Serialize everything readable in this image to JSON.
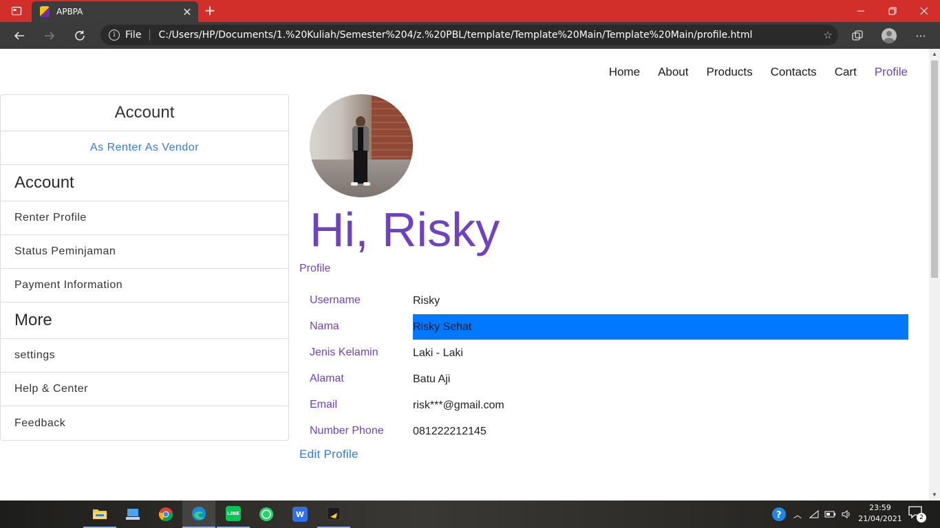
{
  "browser": {
    "tab_title": "APBPA",
    "tab_close": "✕",
    "new_tab": "+",
    "scheme_label": "File",
    "url": "C:/Users/HP/Documents/1.%20Kuliah/Semester%204/z.%20PBL/template/Template%20Main/Template%20Main/profile.html"
  },
  "nav": {
    "links": [
      "Home",
      "About",
      "Products",
      "Contacts",
      "Cart",
      "Profile"
    ],
    "active": "Profile"
  },
  "sidebar": {
    "header": "Account",
    "role_links": "As Renter As Vendor",
    "section_account": "Account",
    "account_items": [
      "Renter Profile",
      "Status Peminjaman",
      "Payment Information"
    ],
    "section_more": "More",
    "more_items": [
      "settings",
      "Help & Center",
      "Feedback"
    ]
  },
  "profile": {
    "greeting": "Hi, Risky",
    "section_label": "Profile",
    "fields": [
      {
        "label": "Username",
        "value": "Risky"
      },
      {
        "label": "Nama",
        "value": "Risky Sehat"
      },
      {
        "label": "Jenis Kelamin",
        "value": "Laki - Laki"
      },
      {
        "label": "Alamat",
        "value": "Batu Aji"
      },
      {
        "label": "Email",
        "value": "risk***@gmail.com"
      },
      {
        "label": "Number Phone",
        "value": "081222212145"
      }
    ],
    "edit_link": "Edit Profile"
  },
  "taskbar": {
    "clock_time": "23:59",
    "clock_date": "21/04/2021",
    "notification_count": "2"
  },
  "colors": {
    "accent_purple": "#6f42c1",
    "link_blue": "#2c7be5",
    "selection_blue": "#0078ff",
    "tabbar_red": "#d32f2a"
  }
}
